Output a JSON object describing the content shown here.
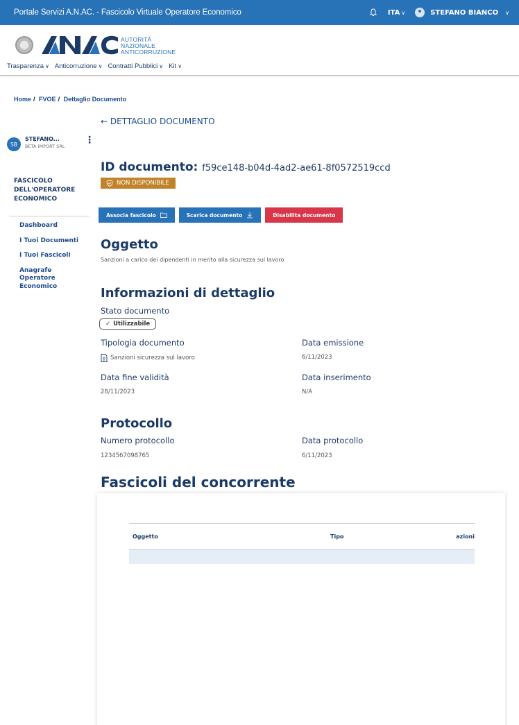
{
  "topbar": {
    "title": "Portale Servizi A.N.AC. - Fascicolo Virtuale Operatore Economico",
    "language": "ITA",
    "user": "STEFANO BIANCO"
  },
  "header": {
    "logo_text": "ANAC",
    "logo_sub_1": "AUTORITÀ",
    "logo_sub_2": "NAZIONALE",
    "logo_sub_3": "ANTICORRUZIONE",
    "nav": [
      "Trasparenza",
      "Anticorruzione",
      "Contratti Pubblici",
      "Kit"
    ]
  },
  "breadcrumb": {
    "home": "Home",
    "fvoe": "FVOE",
    "current": "Dettaglio Documento"
  },
  "back_link": "DETTAGLIO DOCUMENTO",
  "user_card": {
    "initials": "SB",
    "name": "STEFANO...",
    "company": "BETA IMPORT SRL"
  },
  "sidebar": {
    "heading": "FASCICOLO DELL'OPERATORE ECONOMICO",
    "items": [
      "Dashboard",
      "I Tuoi Documenti",
      "I Tuoi Fascicoli",
      "Anagrafe Operatore Economico"
    ]
  },
  "document": {
    "id_label": "ID documento:",
    "id_value": "f59ce148-b04d-4ad2-ae61-8f0572519ccd",
    "status_badge": "NON DISPONIBILE",
    "buttons": {
      "associa": "Associa fascicolo",
      "scarica": "Scarica documento",
      "disabilita": "Disabilita documento"
    },
    "oggetto_heading": "Oggetto",
    "oggetto_text": "Sanzioni a carico dei dipendenti in merito alla sicurezza sul lavoro",
    "info_heading": "Informazioni di dettaglio",
    "stato_label": "Stato documento",
    "stato_value": "Utilizzabile",
    "tipologia_label": "Tipologia documento",
    "tipologia_value": "Sanzioni sicurezza sul lavoro",
    "data_emissione_label": "Data emissione",
    "data_emissione_value": "6/11/2023",
    "data_fine_label": "Data fine validità",
    "data_fine_value": "28/11/2023",
    "data_inserimento_label": "Data inserimento",
    "data_inserimento_value": "N/A",
    "protocollo_heading": "Protocollo",
    "numero_protocollo_label": "Numero protocollo",
    "numero_protocollo_value": "1234567098765",
    "data_protocollo_label": "Data protocollo",
    "data_protocollo_value": "6/11/2023"
  },
  "fascicoli": {
    "heading": "Fascicoli del concorrente",
    "columns": [
      "Oggetto",
      "Tipo",
      "azioni"
    ]
  },
  "colors": {
    "primary": "#2872b8",
    "navy": "#1b3a66",
    "warning": "#c1832a",
    "danger": "#d9364a"
  }
}
